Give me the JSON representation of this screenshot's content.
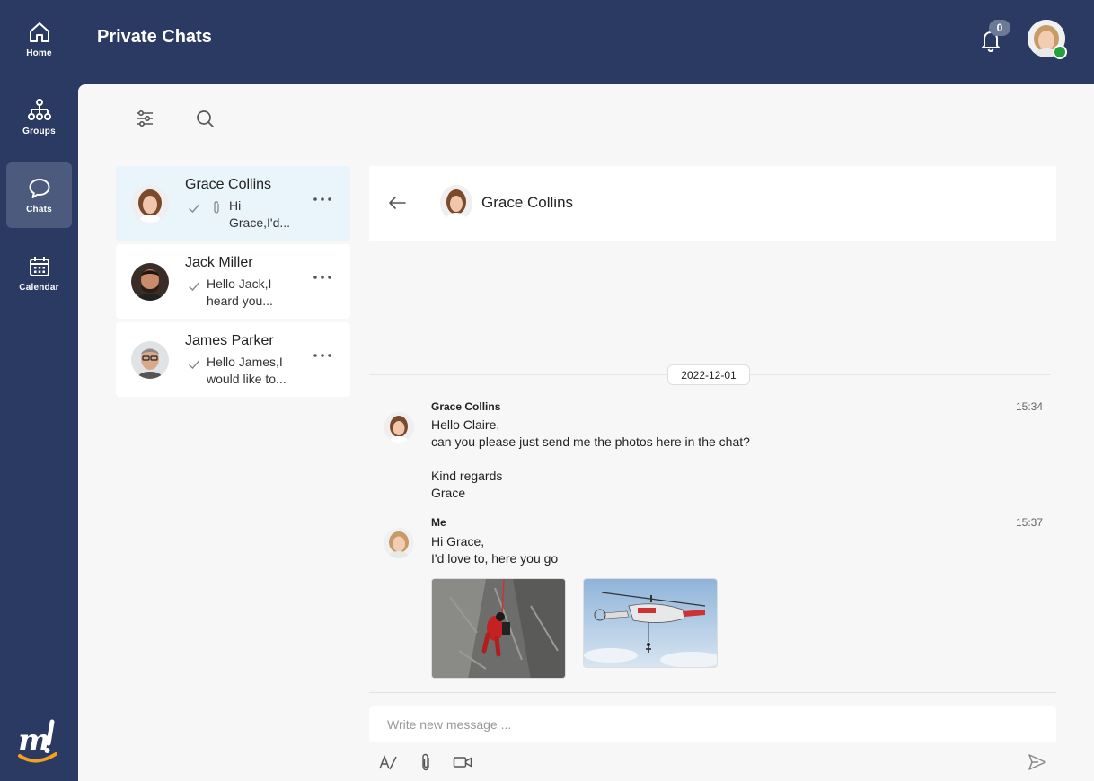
{
  "nav": {
    "items": [
      {
        "label": "Home",
        "icon": "home-icon"
      },
      {
        "label": "Groups",
        "icon": "groups-icon"
      },
      {
        "label": "Chats",
        "icon": "chat-bubble-icon"
      },
      {
        "label": "Calendar",
        "icon": "calendar-icon"
      }
    ],
    "active": "Chats"
  },
  "header": {
    "title": "Private Chats",
    "notification_count": "0"
  },
  "chat_list": [
    {
      "name": "Grace Collins",
      "preview_lines": [
        "Hi",
        "Grace,I'd..."
      ],
      "has_attachment": true,
      "selected": true
    },
    {
      "name": "Jack Miller",
      "preview_lines": [
        "Hello Jack,I",
        "heard you..."
      ],
      "has_attachment": false,
      "selected": false
    },
    {
      "name": "James Parker",
      "preview_lines": [
        "Hello James,I",
        "would like to..."
      ],
      "has_attachment": false,
      "selected": false
    }
  ],
  "conversation": {
    "title": "Grace Collins",
    "date": "2022-12-01",
    "messages": [
      {
        "sender": "Grace Collins",
        "time": "15:34",
        "lines": [
          "Hello Claire,",
          "can you please just send me the photos here in the chat?",
          "",
          "Kind regards",
          "Grace"
        ]
      },
      {
        "sender": "Me",
        "time": "15:37",
        "lines": [
          "Hi Grace,",
          "I'd love to, here you go"
        ]
      }
    ]
  },
  "compose": {
    "placeholder": "Write new message ..."
  },
  "colors": {
    "rail": "#2b3a63",
    "rail_active": "#4b5a7d",
    "panel": "#f7f7f7",
    "selected_item": "#e9f4fb",
    "online": "#23a13a"
  }
}
